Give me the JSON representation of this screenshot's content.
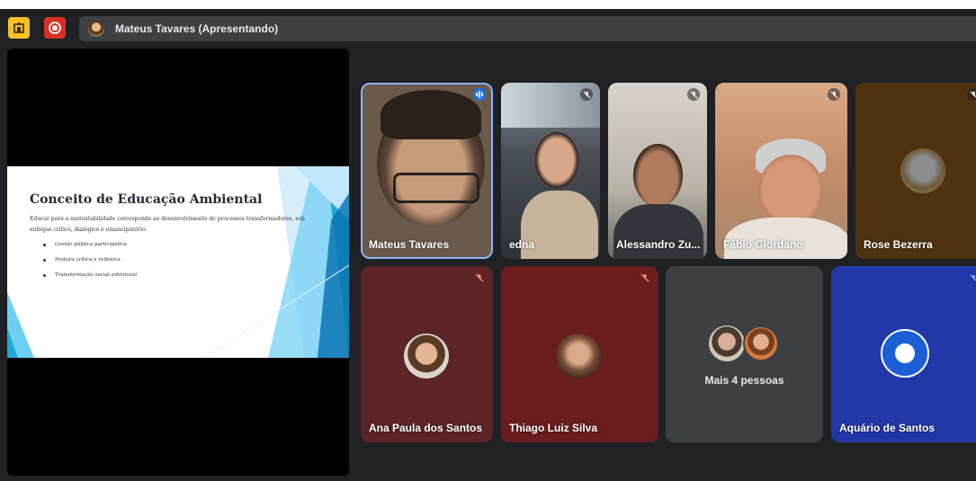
{
  "header": {
    "presenter_label": "Mateus Tavares (Apresentando)"
  },
  "slide": {
    "title": "Conceito de Educação Ambiental",
    "body": "Educar para a sustentabilidade corresponde ao desenvolvimento de processos transformadores, sob enfoque crítico, dialógico e emancipatório.",
    "bullets": [
      "Gestão pública participativa",
      "Postura crítica e reflexiva",
      "Transformação social estrutural"
    ]
  },
  "participants": {
    "top_row": [
      "Mateus Tavares",
      "edna",
      "Alessandro Zu...",
      "Fábio Giordano",
      "Rose Bezerra"
    ],
    "bottom_row": [
      "Ana Paula dos Santos",
      "Thiago Luiz Silva",
      "Aquário de Santos"
    ],
    "more_label": "Mais 4 pessoas"
  },
  "icons": {
    "app": "meet-app-icon",
    "record": "record-icon",
    "mic_off": "mic-off-icon",
    "speaking": "speaking-indicator-icon"
  },
  "colors": {
    "background": "#202124",
    "tile_maroon": "#5c2426",
    "tile_red": "#6b1d1d",
    "tile_gray": "#3c4043",
    "tile_blue": "#2338a8",
    "mute_red": "#f28b82",
    "speaking_blue": "#8ab4f8"
  }
}
